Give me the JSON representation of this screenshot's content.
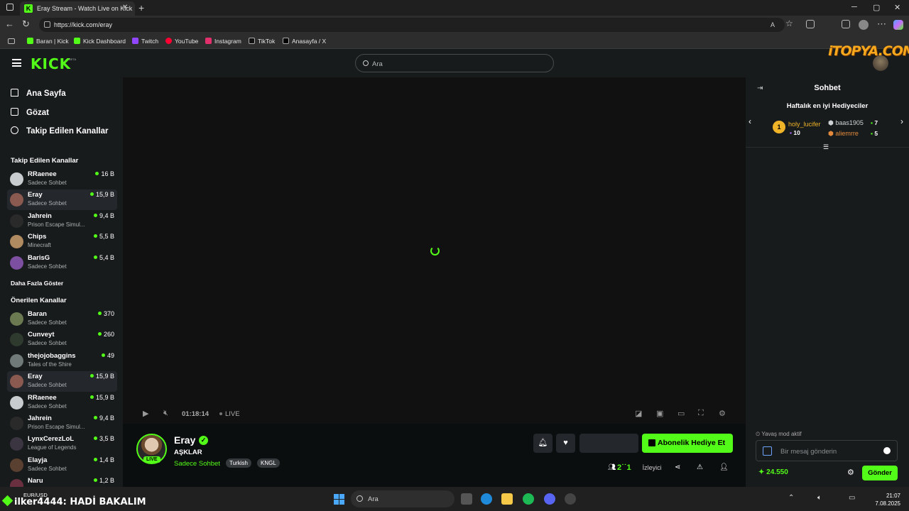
{
  "browser": {
    "tab_title": "Eray Stream - Watch Live on Kick",
    "url": "https://kick.com/eray",
    "bookmarks": [
      "Baran | Kick",
      "Kick Dashboard",
      "Twitch",
      "YouTube",
      "Instagram",
      "TikTok",
      "Anasayfa / X"
    ]
  },
  "header": {
    "logo": "KICK",
    "beta": "BETA",
    "search_placeholder": "Ara",
    "watermark": "iTOPYA.COM"
  },
  "sidebar": {
    "nav": [
      "Ana Sayfa",
      "Gözat",
      "Takip Edilen Kanallar"
    ],
    "followed_title": "Takip Edilen Kanallar",
    "followed": [
      {
        "name": "RRaenee",
        "sub": "Sadece Sohbet",
        "viewers": "16 B"
      },
      {
        "name": "Eray",
        "sub": "Sadece Sohbet",
        "viewers": "15,9 B"
      },
      {
        "name": "Jahrein",
        "sub": "Prison Escape Simul...",
        "viewers": "9,4 B"
      },
      {
        "name": "Chips",
        "sub": "Minecraft",
        "viewers": "5,5 B"
      },
      {
        "name": "BarisG",
        "sub": "Sadece Sohbet",
        "viewers": "5,4 B"
      }
    ],
    "show_more": "Daha Fazla Göster",
    "recommended_title": "Önerilen Kanallar",
    "recommended": [
      {
        "name": "Baran",
        "sub": "Sadece Sohbet",
        "viewers": "370"
      },
      {
        "name": "Cunveyt",
        "sub": "Sadece Sohbet",
        "viewers": "260"
      },
      {
        "name": "thejojobaggins",
        "sub": "Tales of the Shire",
        "viewers": "49"
      },
      {
        "name": "Eray",
        "sub": "Sadece Sohbet",
        "viewers": "15,9 B"
      },
      {
        "name": "RRaenee",
        "sub": "Sadece Sohbet",
        "viewers": "15,9 B"
      },
      {
        "name": "Jahrein",
        "sub": "Prison Escape Simul...",
        "viewers": "9,4 B"
      },
      {
        "name": "LynxCerezLoL",
        "sub": "League of Legends",
        "viewers": "3,5 B"
      },
      {
        "name": "Elayja",
        "sub": "Sadece Sohbet",
        "viewers": "1,4 B"
      },
      {
        "name": "Naru",
        "sub": "",
        "viewers": "1,2 B"
      }
    ]
  },
  "player": {
    "time": "01:18:14",
    "live": "LIVE"
  },
  "stream": {
    "name": "Eray",
    "title": "AŞKLAR",
    "category": "Sadece Sohbet",
    "tags": [
      "Turkish",
      "KNGL"
    ],
    "live_badge": "LIVE",
    "gift_button": "Abonelik Hediye Et",
    "viewer_count": "2˙˙1",
    "viewer_label": "İzleyici"
  },
  "chat": {
    "title": "Sohbet",
    "gifters_title": "Haftalık en iyi Hediyeciler",
    "gifters": [
      {
        "rank": "1",
        "name": "holy_lucifer",
        "count": "10",
        "color": "#f0b429"
      },
      {
        "name": "baas1905",
        "count": "7",
        "color": "#cfd2d4"
      },
      {
        "name": "aliemrre",
        "count": "5",
        "color": "#e48a3c"
      }
    ],
    "slow_mode": "Yavaş mod aktif",
    "message_placeholder": "Bir mesaj gönderin",
    "points": "24.550",
    "send": "Gönder"
  },
  "taskbar": {
    "ticker_label": "EUR/USD",
    "overlay_user": "ilker4444",
    "overlay_msg": ": HADİ BAKALIM",
    "search": "Ara",
    "time": "21:07",
    "date": "7.08.2025"
  },
  "colors": {
    "accent": "#53fc18",
    "background": "#0b0e0f",
    "panel": "#181b1c"
  }
}
